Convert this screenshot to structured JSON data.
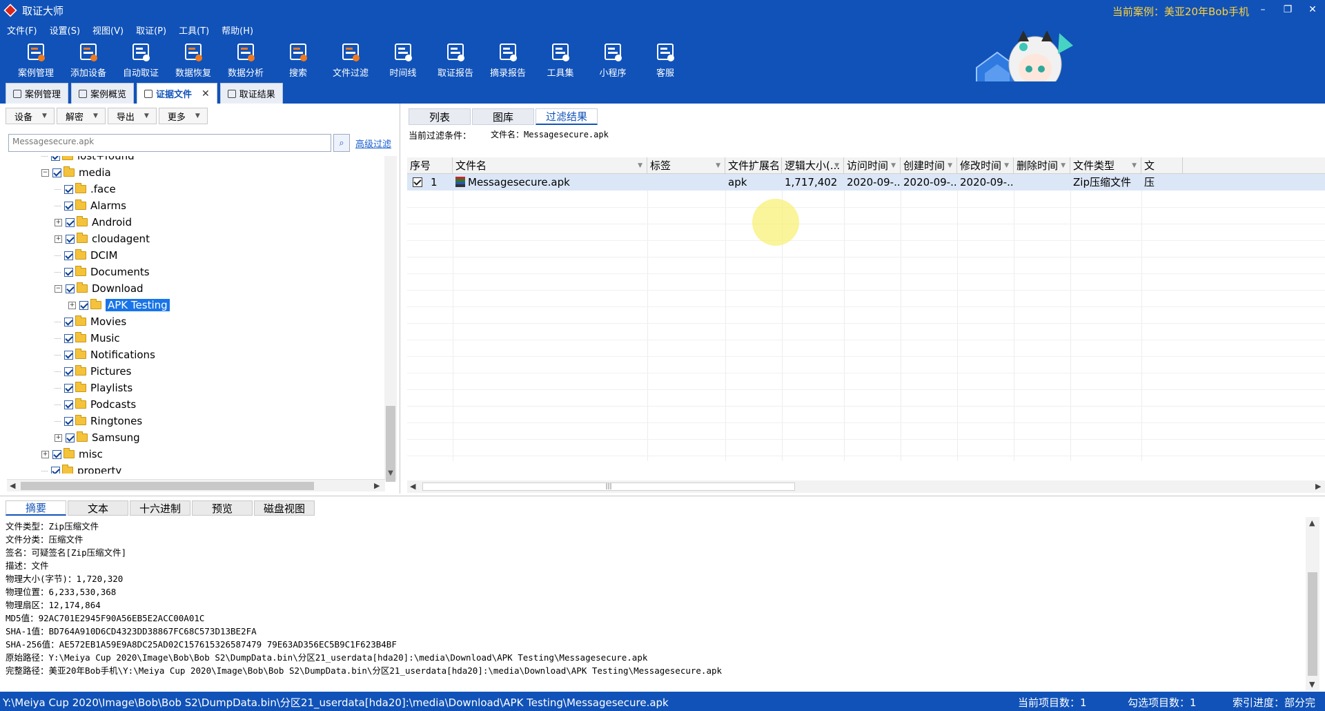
{
  "window": {
    "title": "取证大师",
    "current_case": "当前案例：美亚20年Bob手机",
    "min": "–",
    "restore": "❐",
    "close": "✕"
  },
  "menu": [
    "文件(F)",
    "设置(S)",
    "视图(V)",
    "取证(P)",
    "工具(T)",
    "帮助(H)"
  ],
  "toolbar": [
    {
      "label": "案例管理",
      "icon": "case-manage-icon",
      "color": "#f07a1e"
    },
    {
      "label": "添加设备",
      "icon": "add-device-icon",
      "color": "#f07a1e"
    },
    {
      "label": "自动取证",
      "icon": "auto-forensics-icon",
      "color": "#ffffff"
    },
    {
      "label": "数据恢复",
      "icon": "data-recovery-icon",
      "color": "#f07a1e"
    },
    {
      "label": "数据分析",
      "icon": "data-analysis-icon",
      "color": "#f07a1e"
    },
    {
      "label": "搜索",
      "icon": "search-doc-icon",
      "color": "#f07a1e"
    },
    {
      "label": "文件过滤",
      "icon": "file-filter-icon",
      "color": "#f07a1e"
    },
    {
      "label": "时间线",
      "icon": "timeline-icon",
      "color": "#ffffff"
    },
    {
      "label": "取证报告",
      "icon": "forensic-report-icon",
      "color": "#ffffff"
    },
    {
      "label": "摘录报告",
      "icon": "extract-report-icon",
      "color": "#ffffff"
    },
    {
      "label": "工具集",
      "icon": "toolset-icon",
      "color": "#ffffff"
    },
    {
      "label": "小程序",
      "icon": "mini-program-icon",
      "color": "#ffffff"
    },
    {
      "label": "客服",
      "icon": "customer-service-icon",
      "color": "#ffffff"
    }
  ],
  "doc_tabs": [
    {
      "label": "案例管理",
      "active": false
    },
    {
      "label": "案例概览",
      "active": false
    },
    {
      "label": "证据文件",
      "active": true
    },
    {
      "label": "取证结果",
      "active": false
    }
  ],
  "left": {
    "buttons": [
      "设备",
      "解密",
      "导出",
      "更多"
    ],
    "search_value": "Messagesecure.apk",
    "advanced_filter": "高级过滤",
    "tree": [
      {
        "label": "lost+found",
        "level": 2,
        "exp": "none"
      },
      {
        "label": "media",
        "level": 2,
        "exp": "minus"
      },
      {
        "label": ".face",
        "level": 3,
        "exp": "none"
      },
      {
        "label": "Alarms",
        "level": 3,
        "exp": "none"
      },
      {
        "label": "Android",
        "level": 3,
        "exp": "plus"
      },
      {
        "label": "cloudagent",
        "level": 3,
        "exp": "plus"
      },
      {
        "label": "DCIM",
        "level": 3,
        "exp": "none"
      },
      {
        "label": "Documents",
        "level": 3,
        "exp": "none"
      },
      {
        "label": "Download",
        "level": 3,
        "exp": "minus"
      },
      {
        "label": "APK Testing",
        "level": 4,
        "exp": "plus",
        "selected": true
      },
      {
        "label": "Movies",
        "level": 3,
        "exp": "none"
      },
      {
        "label": "Music",
        "level": 3,
        "exp": "none"
      },
      {
        "label": "Notifications",
        "level": 3,
        "exp": "none"
      },
      {
        "label": "Pictures",
        "level": 3,
        "exp": "none"
      },
      {
        "label": "Playlists",
        "level": 3,
        "exp": "none"
      },
      {
        "label": "Podcasts",
        "level": 3,
        "exp": "none"
      },
      {
        "label": "Ringtones",
        "level": 3,
        "exp": "none"
      },
      {
        "label": "Samsung",
        "level": 3,
        "exp": "plus"
      },
      {
        "label": "misc",
        "level": 2,
        "exp": "plus"
      },
      {
        "label": "property",
        "level": 2,
        "exp": "none"
      }
    ]
  },
  "right": {
    "tabs": [
      {
        "label": "列表",
        "active": false
      },
      {
        "label": "图库",
        "active": false
      },
      {
        "label": "过滤结果",
        "active": true
      }
    ],
    "filter_label": "当前过滤条件：",
    "filter_value": "文件名：Messagesecure.apk",
    "columns": [
      "序号",
      "文件名",
      "标签",
      "文件扩展名",
      "逻辑大小(...",
      "访问时间",
      "创建时间",
      "修改时间",
      "删除时间",
      "文件类型",
      "文"
    ],
    "rows": [
      {
        "index": "1",
        "name": "Messagesecure.apk",
        "tag": "",
        "ext": "apk",
        "size": "1,717,402",
        "atime": "2020-09-...",
        "ctime": "2020-09-...",
        "mtime": "2020-09-...",
        "dtime": "",
        "type": "Zip压缩文件",
        "extra": "压"
      }
    ],
    "hscroll_grip": "|||"
  },
  "bottom": {
    "tabs": [
      {
        "label": "摘要",
        "active": true
      },
      {
        "label": "文本",
        "active": false
      },
      {
        "label": "十六进制",
        "active": false
      },
      {
        "label": "预览",
        "active": false
      },
      {
        "label": "磁盘视图",
        "active": false
      }
    ],
    "details": [
      "文件类型：Zip压缩文件",
      "文件分类：压缩文件",
      "签名：可疑签名[Zip压缩文件]",
      "描述：文件",
      "物理大小(字节)：1,720,320",
      "物理位置：6,233,530,368",
      "物理扇区：12,174,864",
      "MD5值：92AC701E2945F90A56EB5E2ACC00A01C",
      "SHA-1值：BD764A910D6CD4323DD38867FC68C573D13BE2FA",
      "SHA-256值：AE572EB1A59E9A8DC25AD02C157615326587479 79E63AD356EC5B9C1F623B4BF",
      "原始路径：Y:\\Meiya Cup 2020\\Image\\Bob\\Bob S2\\DumpData.bin\\分区21_userdata[hda20]:\\media\\Download\\APK Testing\\Messagesecure.apk",
      "完整路径：美亚20年Bob手机\\Y:\\Meiya Cup 2020\\Image\\Bob\\Bob S2\\DumpData.bin\\分区21_userdata[hda20]:\\media\\Download\\APK Testing\\Messagesecure.apk"
    ]
  },
  "status": {
    "path": "Y:\\Meiya Cup 2020\\Image\\Bob\\Bob S2\\DumpData.bin\\分区21_userdata[hda20]:\\media\\Download\\APK Testing\\Messagesecure.apk",
    "current_items": "当前项目数：1",
    "selected_items": "勾选项目数：1",
    "index_progress": "索引进度：部分完成"
  }
}
